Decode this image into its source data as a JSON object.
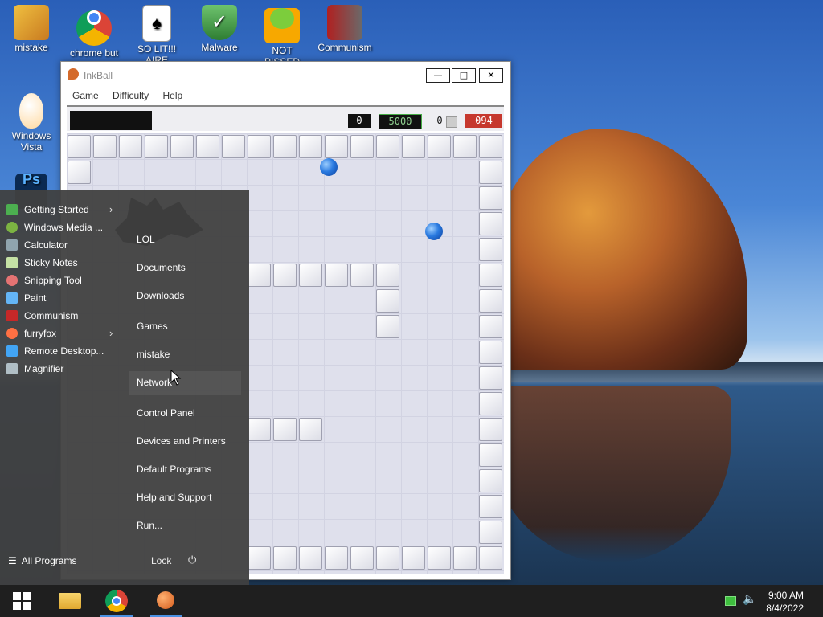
{
  "desktop_icons": [
    {
      "label": "mistake",
      "icon": "computer-icon"
    },
    {
      "label": "chrome but",
      "icon": "chrome-icon"
    },
    {
      "label": "SO LIT!!! AIRE",
      "icon": "solitaire-icon"
    },
    {
      "label": "Malware",
      "icon": "shield-icon"
    },
    {
      "label": "NOT PISSED",
      "icon": "angry-bird-icon"
    },
    {
      "label": "Communism",
      "icon": "flag-icon"
    },
    {
      "label": "Windows Vista",
      "icon": "egg-icon"
    },
    {
      "label": "Ps",
      "icon": "photoshop-icon"
    }
  ],
  "inkball": {
    "title": "InkBall",
    "menu": [
      "Game",
      "Difficulty",
      "Help"
    ],
    "window_buttons": {
      "minimize": "—",
      "maximize": "□",
      "close": "✕"
    },
    "score": "0",
    "time": "5000",
    "balls": "0",
    "level": "094"
  },
  "start_menu": {
    "programs": [
      {
        "label": "Getting Started",
        "has_submenu": true,
        "icon": "getting-started-icon",
        "color": "#4caf50"
      },
      {
        "label": "Windows Media ...",
        "has_submenu": false,
        "icon": "media-player-icon",
        "color": "#7cb342"
      },
      {
        "label": "Calculator",
        "has_submenu": false,
        "icon": "calculator-icon",
        "color": "#90a4ae"
      },
      {
        "label": "Sticky Notes",
        "has_submenu": false,
        "icon": "sticky-notes-icon",
        "color": "#c5e1a5"
      },
      {
        "label": "Snipping Tool",
        "has_submenu": false,
        "icon": "scissors-icon",
        "color": "#e57373"
      },
      {
        "label": "Paint",
        "has_submenu": false,
        "icon": "paint-icon",
        "color": "#64b5f6"
      },
      {
        "label": "Communism",
        "has_submenu": false,
        "icon": "flag-icon",
        "color": "#c62828"
      },
      {
        "label": "furryfox",
        "has_submenu": true,
        "icon": "firefox-icon",
        "color": "#ff7043"
      },
      {
        "label": "Remote Desktop...",
        "has_submenu": false,
        "icon": "remote-desktop-icon",
        "color": "#42a5f5"
      },
      {
        "label": "Magnifier",
        "has_submenu": false,
        "icon": "magnifier-icon",
        "color": "#b0bec5"
      }
    ],
    "places": [
      "LOL",
      "Documents",
      "Downloads",
      "Games",
      "mistake",
      "Network",
      "Control Panel",
      "Devices and Printers",
      "Default Programs",
      "Help and Support",
      "Run..."
    ],
    "all_programs": "All Programs",
    "lock": "Lock",
    "power_symbol": "⏻"
  },
  "clock": {
    "time": "9:00 AM",
    "date": "8/4/2022"
  }
}
